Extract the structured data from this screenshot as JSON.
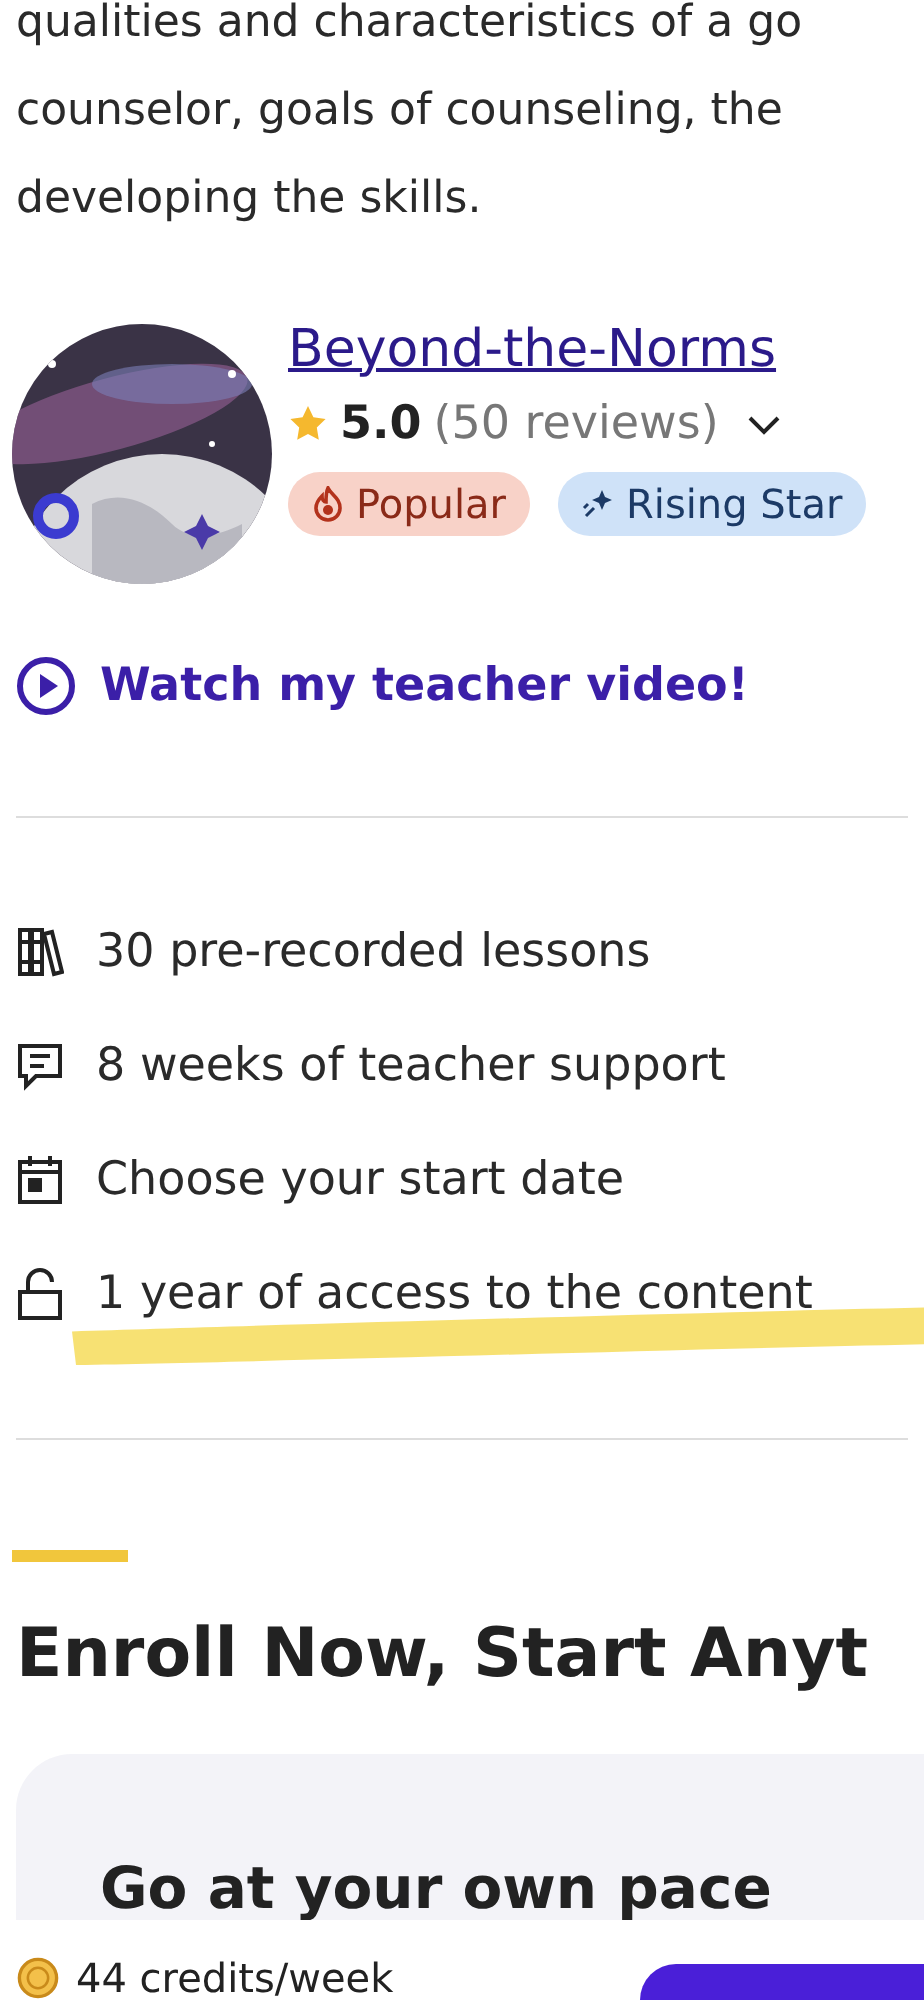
{
  "description_lines": [
    "qualities and characteristics of a go",
    "counselor, goals of counseling, the",
    "developing the skills."
  ],
  "teacher": {
    "name": "Beyond-the-Norms",
    "rating": "5.0",
    "reviews": "(50 reviews)",
    "expanded": false,
    "badges": [
      {
        "kind": "popular",
        "label": "Popular"
      },
      {
        "kind": "rising",
        "label": "Rising Star"
      }
    ],
    "video_link": "Watch my teacher video!"
  },
  "features": [
    {
      "kind": "lessons",
      "text": "30 pre-recorded lessons",
      "highlighted": false
    },
    {
      "kind": "support",
      "text": "8 weeks of teacher support",
      "highlighted": false
    },
    {
      "kind": "calendar",
      "text": "Choose your start date",
      "highlighted": false
    },
    {
      "kind": "access",
      "text": "1 year of access to the content",
      "highlighted": true
    }
  ],
  "section_title": "Enroll Now, Start Anyt",
  "card_title": "Go at your own pace",
  "bottom_bar": {
    "price": "44 credits/week"
  }
}
